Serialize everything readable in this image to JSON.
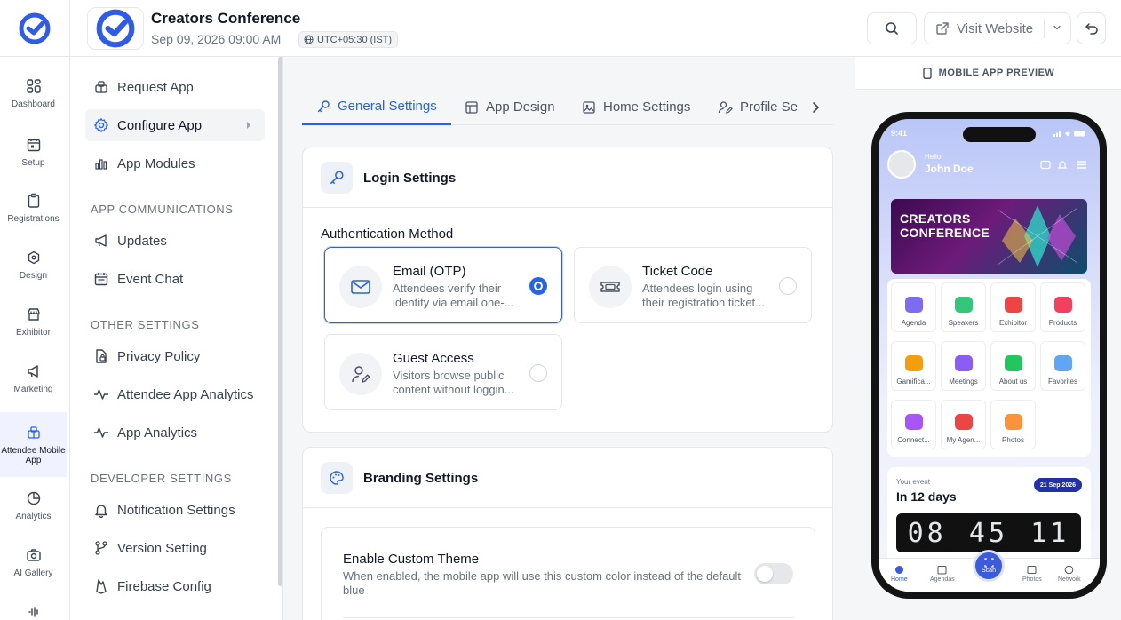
{
  "header": {
    "event_title": "Creators Conference",
    "event_date": "Sep 09, 2026 09:00 AM",
    "timezone": "UTC+05:30 (IST)",
    "visit_website": "Visit Website"
  },
  "rail": {
    "items": [
      {
        "label": "Dashboard",
        "icon": "dashboard-icon"
      },
      {
        "label": "Setup",
        "icon": "calendar-icon"
      },
      {
        "label": "Registrations",
        "icon": "clipboard-icon"
      },
      {
        "label": "Design",
        "icon": "design-icon"
      },
      {
        "label": "Exhibitor",
        "icon": "store-icon"
      },
      {
        "label": "Marketing",
        "icon": "megaphone-icon"
      },
      {
        "label": "Attendee Mobile App",
        "icon": "app-icon",
        "active": true
      },
      {
        "label": "Analytics",
        "icon": "pie-chart-icon"
      },
      {
        "label": "AI Gallery",
        "icon": "camera-icon"
      }
    ]
  },
  "submenu": {
    "request_app": "Request App",
    "configure_app": "Configure App",
    "app_modules": "App Modules",
    "app_comms_heading": "APP COMMUNICATIONS",
    "updates": "Updates",
    "event_chat": "Event Chat",
    "other_heading": "OTHER SETTINGS",
    "privacy_policy": "Privacy Policy",
    "attendee_analytics": "Attendee App Analytics",
    "app_analytics": "App Analytics",
    "developer_heading": "DEVELOPER SETTINGS",
    "notification_settings": "Notification Settings",
    "version_setting": "Version Setting",
    "firebase_config": "Firebase Config"
  },
  "tabs": {
    "general": "General Settings",
    "design": "App Design",
    "home": "Home Settings",
    "profile": "Profile Se"
  },
  "login": {
    "title": "Login Settings",
    "auth_label": "Authentication Method",
    "options": [
      {
        "title": "Email (OTP)",
        "desc": "Attendees verify their identity via email one-...",
        "selected": true
      },
      {
        "title": "Ticket Code",
        "desc": "Attendees login using their registration ticket...",
        "selected": false
      },
      {
        "title": "Guest Access",
        "desc": "Visitors browse public content without loggin...",
        "selected": false
      }
    ]
  },
  "branding": {
    "title": "Branding Settings",
    "theme_title": "Enable Custom Theme",
    "theme_desc": "When enabled, the mobile app will use this custom color instead of the default blue",
    "theme_enabled": false
  },
  "preview": {
    "heading": "MOBILE APP PREVIEW",
    "time": "9:41",
    "hello": "Hello",
    "user_name": "John Doe",
    "banner_line1": "CREATORS",
    "banner_line2": "CONFERENCE",
    "modules": [
      "Agenda",
      "Speakers",
      "Exhibitor",
      "Products",
      "Gamifica...",
      "Meetings",
      "About us",
      "Favorites",
      "Connect...",
      "My Agen...",
      "Photos"
    ],
    "your_event": "Your event",
    "days_left": "In 12 days",
    "event_badge": "21 Sep 2026",
    "countdown": [
      "08",
      "45",
      "11"
    ],
    "nav": {
      "home": "Home",
      "agendas": "Agendas",
      "scan": "Scan",
      "photos": "Photos",
      "network": "Network"
    }
  },
  "colors": {
    "accent": "#2563eb",
    "rail_active_bg": "#f0f3ff",
    "badge": "#2430a8"
  }
}
